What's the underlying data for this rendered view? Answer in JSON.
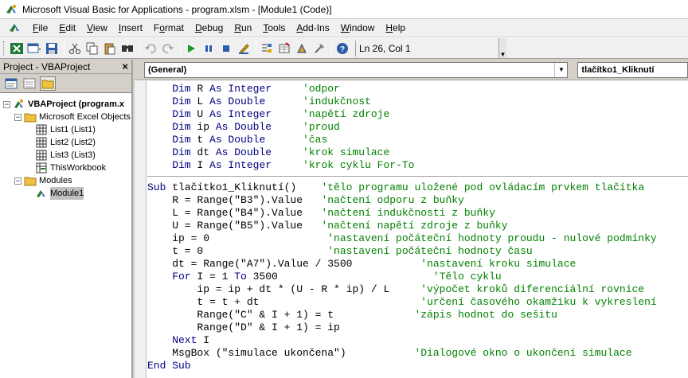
{
  "window": {
    "title": "Microsoft Visual Basic for Applications - program.xlsm - [Module1 (Code)]"
  },
  "menu": [
    {
      "label": "File",
      "u": "F",
      "rest": "ile"
    },
    {
      "label": "Edit",
      "u": "E",
      "rest": "dit"
    },
    {
      "label": "View",
      "u": "V",
      "rest": "iew"
    },
    {
      "label": "Insert",
      "u": "I",
      "rest": "nsert"
    },
    {
      "label": "Format",
      "u": "o",
      "pre": "F",
      "rest": "rmat"
    },
    {
      "label": "Debug",
      "u": "D",
      "rest": "ebug"
    },
    {
      "label": "Run",
      "u": "R",
      "rest": "un"
    },
    {
      "label": "Tools",
      "u": "T",
      "rest": "ools"
    },
    {
      "label": "Add-Ins",
      "u": "A",
      "rest": "dd-Ins"
    },
    {
      "label": "Window",
      "u": "W",
      "rest": "indow"
    },
    {
      "label": "Help",
      "u": "H",
      "rest": "elp"
    }
  ],
  "toolbar": {
    "cursor_position": "Ln 26, Col 1"
  },
  "project": {
    "title": "Project - VBAProject",
    "close": "×",
    "tree": [
      {
        "label": "VBAProject (program.x",
        "level": 0,
        "bold": true,
        "icon": "vbaproject-icon",
        "exp": "−"
      },
      {
        "label": "Microsoft Excel Objects",
        "level": 1,
        "icon": "folder-icon",
        "exp": "−"
      },
      {
        "label": "List1 (List1)",
        "level": 2,
        "icon": "sheet-icon"
      },
      {
        "label": "List2 (List2)",
        "level": 2,
        "icon": "sheet-icon"
      },
      {
        "label": "List3 (List3)",
        "level": 2,
        "icon": "sheet-icon"
      },
      {
        "label": "ThisWorkbook",
        "level": 2,
        "icon": "workbook-icon"
      },
      {
        "label": "Modules",
        "level": 1,
        "icon": "folder-icon",
        "exp": "−"
      },
      {
        "label": "Module1",
        "level": 2,
        "icon": "module-icon",
        "selected": true
      }
    ]
  },
  "code_window": {
    "object_combo": "(General)",
    "procedure_combo": "tlačítko1_Kliknutí",
    "declarations": [
      [
        {
          "k": "kw",
          "t": "    Dim "
        },
        {
          "k": "tx",
          "t": "R "
        },
        {
          "k": "kw",
          "t": "As Integer"
        },
        {
          "k": "cm",
          "t": "     'odpor"
        }
      ],
      [
        {
          "k": "kw",
          "t": "    Dim "
        },
        {
          "k": "tx",
          "t": "L "
        },
        {
          "k": "kw",
          "t": "As Double"
        },
        {
          "k": "cm",
          "t": "      'indukčnost"
        }
      ],
      [
        {
          "k": "kw",
          "t": "    Dim "
        },
        {
          "k": "tx",
          "t": "U "
        },
        {
          "k": "kw",
          "t": "As Integer"
        },
        {
          "k": "cm",
          "t": "     'napětí zdroje"
        }
      ],
      [
        {
          "k": "kw",
          "t": "    Dim "
        },
        {
          "k": "tx",
          "t": "ip "
        },
        {
          "k": "kw",
          "t": "As Double"
        },
        {
          "k": "cm",
          "t": "     'proud"
        }
      ],
      [
        {
          "k": "kw",
          "t": "    Dim "
        },
        {
          "k": "tx",
          "t": "t "
        },
        {
          "k": "kw",
          "t": "As Double"
        },
        {
          "k": "cm",
          "t": "      'čas"
        }
      ],
      [
        {
          "k": "kw",
          "t": "    Dim "
        },
        {
          "k": "tx",
          "t": "dt "
        },
        {
          "k": "kw",
          "t": "As Double"
        },
        {
          "k": "cm",
          "t": "     'krok simulace"
        }
      ],
      [
        {
          "k": "kw",
          "t": "    Dim "
        },
        {
          "k": "tx",
          "t": "I "
        },
        {
          "k": "kw",
          "t": "As Integer"
        },
        {
          "k": "cm",
          "t": "     'krok cyklu For-To"
        }
      ]
    ],
    "procedure": [
      [
        {
          "k": "kw",
          "t": "Sub "
        },
        {
          "k": "tx",
          "t": "tlačítko1_Kliknutí()"
        },
        {
          "k": "cm",
          "t": "    'tělo programu uložené pod ovládacím prvkem tlačítka"
        }
      ],
      [
        {
          "k": "tx",
          "t": "    R = Range(\"B3\").Value"
        },
        {
          "k": "cm",
          "t": "   'načtení odporu z buňky"
        }
      ],
      [
        {
          "k": "tx",
          "t": "    L = Range(\"B4\").Value"
        },
        {
          "k": "cm",
          "t": "   'načtení indukčnosti z buňky"
        }
      ],
      [
        {
          "k": "tx",
          "t": "    U = Range(\"B5\").Value"
        },
        {
          "k": "cm",
          "t": "   'načtení napětí zdroje z buňky"
        }
      ],
      [
        {
          "k": "tx",
          "t": "    ip = 0"
        },
        {
          "k": "cm",
          "t": "                   'nastavení počáteční hodnoty proudu - nulové podmínky"
        }
      ],
      [
        {
          "k": "tx",
          "t": "    t = 0"
        },
        {
          "k": "cm",
          "t": "                    'nastavení počáteční hodnoty času"
        }
      ],
      [
        {
          "k": "tx",
          "t": "    dt = Range(\"A7\").Value / 3500"
        },
        {
          "k": "cm",
          "t": "           'nastavení kroku simulace"
        }
      ],
      [
        {
          "k": "kw",
          "t": "    For "
        },
        {
          "k": "tx",
          "t": "I = 1 "
        },
        {
          "k": "kw",
          "t": "To "
        },
        {
          "k": "tx",
          "t": "3500"
        },
        {
          "k": "cm",
          "t": "                         'Tělo cyklu"
        }
      ],
      [
        {
          "k": "tx",
          "t": "        ip = ip + dt * (U - R * ip) / L"
        },
        {
          "k": "cm",
          "t": "     'výpočet kroků diferenciální rovnice"
        }
      ],
      [
        {
          "k": "tx",
          "t": "        t = t + dt"
        },
        {
          "k": "cm",
          "t": "                          'určení časového okamžiku k vykreslení"
        }
      ],
      [
        {
          "k": "tx",
          "t": "        Range(\"C\" & I + 1) = t"
        },
        {
          "k": "cm",
          "t": "             'zápis hodnot do sešitu"
        }
      ],
      [
        {
          "k": "tx",
          "t": "        Range(\"D\" & I + 1) = ip"
        }
      ],
      [
        {
          "k": "kw",
          "t": "    Next "
        },
        {
          "k": "tx",
          "t": "I"
        }
      ],
      [
        {
          "k": "tx",
          "t": "    MsgBox (\"simulace ukončena\")"
        },
        {
          "k": "cm",
          "t": "           'Dialogové okno o ukončení simulace"
        }
      ],
      [
        {
          "k": "kw",
          "t": "End Sub"
        }
      ]
    ]
  },
  "colors": {
    "keyword": "#000080",
    "comment": "#008000",
    "text": "#000000"
  }
}
